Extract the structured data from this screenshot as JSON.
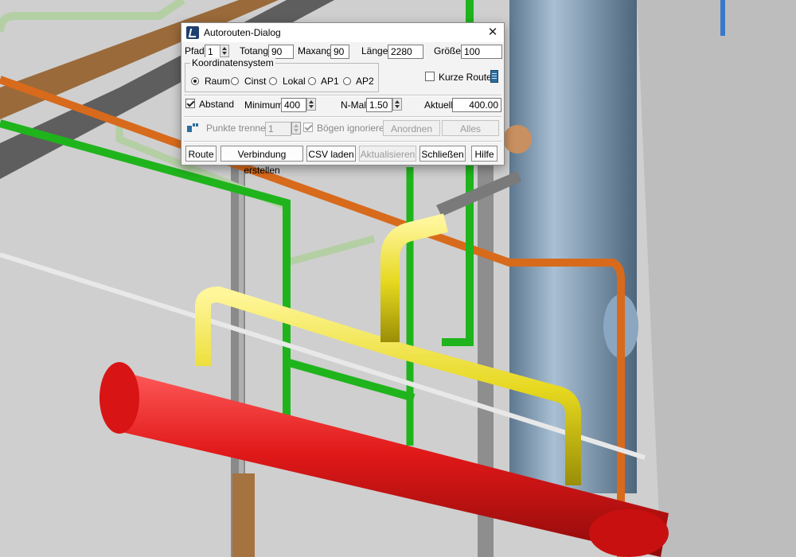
{
  "dialog": {
    "title": "Autorouten-Dialog",
    "close_symbol": "✕",
    "fields": {
      "pfad_label": "Pfad",
      "pfad_value": "1",
      "totang_label": "Totang",
      "totang_value": "90",
      "maxang_label": "Maxang",
      "maxang_value": "90",
      "laenge_label": "Länge",
      "laenge_value": "2280",
      "groesse_label": "Größe",
      "groesse_value": "100"
    },
    "koordinatensystem": {
      "title": "Koordinatensystem",
      "options": [
        "Raum",
        "Cinst",
        "Lokal",
        "AP1",
        "AP2"
      ],
      "selected": "Raum"
    },
    "kurze_route": {
      "label": "Kurze Route",
      "checked": false
    },
    "abstand": {
      "label": "Abstand",
      "checked": true,
      "minimum_label": "Minimum",
      "minimum_value": "400",
      "nmal_label": "N-Mal",
      "nmal_value": "1.50",
      "aktuell_label": "Aktuell",
      "aktuell_value": "400.00"
    },
    "punkte": {
      "label": "Punkte trennen",
      "value": "1",
      "boegen_label": "Bögen ignorieren",
      "boegen_checked": true,
      "anordnen": "Anordnen",
      "alles": "Alles"
    },
    "buttons": {
      "route": "Route",
      "verbindung": "Verbindung erstellen",
      "csv": "CSV laden",
      "aktualisieren": "Aktualisieren",
      "schliessen": "Schließen",
      "hilfe": "Hilfe"
    }
  },
  "icons": {
    "app": "app-logo-icon",
    "route": "route-settings-icon",
    "points": "split-points-icon"
  },
  "colors": {
    "pipe_orange": "#d86a1c",
    "pipe_yellow": "#e6d81e",
    "pipe_green": "#1fb41c",
    "pipe_sage": "#b4cfa4",
    "vessel_red": "#e01818",
    "column_blue": "#7a98b4",
    "steel_gray": "#6a6a6a",
    "background": "#c9c9c9"
  }
}
